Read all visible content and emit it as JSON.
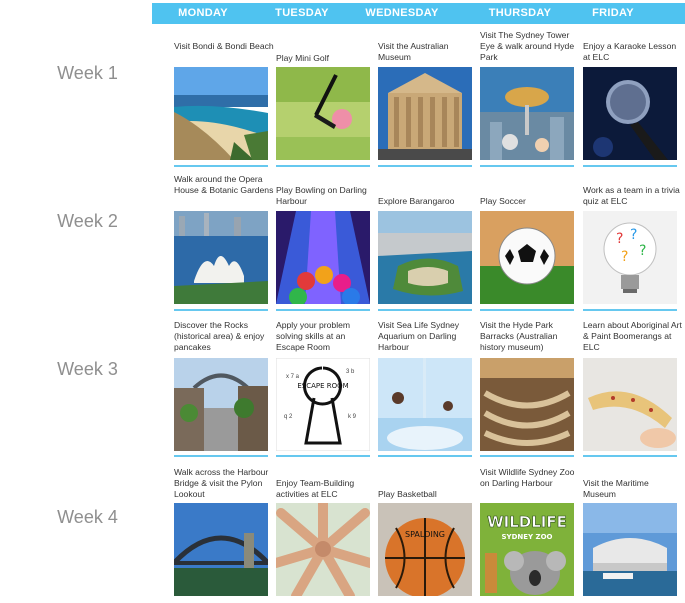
{
  "days": [
    "MONDAY",
    "TUESDAY",
    "WEDNESDAY",
    "THURSDAY",
    "FRIDAY"
  ],
  "weeks": [
    {
      "label": "Week 1",
      "activities": [
        {
          "text": "Visit Bondi & Bondi Beach",
          "icon": "beach-photo"
        },
        {
          "text": "Play Mini Golf",
          "icon": "mini-golf-photo"
        },
        {
          "text": "Visit the Australian Museum",
          "icon": "museum-photo"
        },
        {
          "text": "Visit The Sydney Tower Eye & walk around Hyde Park",
          "icon": "sydney-tower-photo"
        },
        {
          "text": "Enjoy a Karaoke Lesson at ELC",
          "icon": "microphone-photo"
        }
      ]
    },
    {
      "label": "Week 2",
      "activities": [
        {
          "text": "Walk around the Opera House & Botanic Gardens",
          "icon": "opera-house-photo"
        },
        {
          "text": "Play Bowling on Darling Harbour",
          "icon": "bowling-photo"
        },
        {
          "text": "Explore Barangaroo",
          "icon": "barangaroo-photo"
        },
        {
          "text": "Play Soccer",
          "icon": "soccer-ball-photo"
        },
        {
          "text": "Work as a team in a trivia quiz at ELC",
          "icon": "question-lightbulb-photo"
        }
      ]
    },
    {
      "label": "Week 3",
      "activities": [
        {
          "text": "Discover the Rocks (historical area) & enjoy pancakes",
          "icon": "the-rocks-photo"
        },
        {
          "text": "Apply your problem solving skills at an Escape Room",
          "icon": "escape-room-keyhole-photo"
        },
        {
          "text": "Visit Sea Life Sydney Aquarium on Darling Harbour",
          "icon": "aquarium-photo"
        },
        {
          "text": "Visit the Hyde Park Barracks (Australian history museum)",
          "icon": "barracks-hammocks-photo"
        },
        {
          "text": "Learn about Aboriginal Art & Paint Boomerangs at ELC",
          "icon": "boomerang-painting-photo"
        }
      ]
    },
    {
      "label": "Week 4",
      "activities": [
        {
          "text": "Walk across the Harbour Bridge & visit the Pylon Lookout",
          "icon": "harbour-bridge-photo"
        },
        {
          "text": "Enjoy Team-Building activities at ELC",
          "icon": "team-hands-photo"
        },
        {
          "text": "Play Basketball",
          "icon": "basketball-photo"
        },
        {
          "text": "Visit Wildlife Sydney Zoo on Darling Harbour",
          "icon": "wildlife-zoo-photo"
        },
        {
          "text": "Visit the Maritime Museum",
          "icon": "maritime-museum-photo"
        }
      ]
    }
  ],
  "image_text": {
    "escape_room": "ESCAPE ROOM",
    "basketball_brand": "SPALDING",
    "wildlife_title": "WILDLIFE",
    "wildlife_subtitle": "SYDNEY ZOO"
  },
  "colors": {
    "header_bg": "#4fc3f0",
    "divider": "#66c8ef",
    "week_label": "#8f8f8f",
    "caption_text": "#333333"
  }
}
